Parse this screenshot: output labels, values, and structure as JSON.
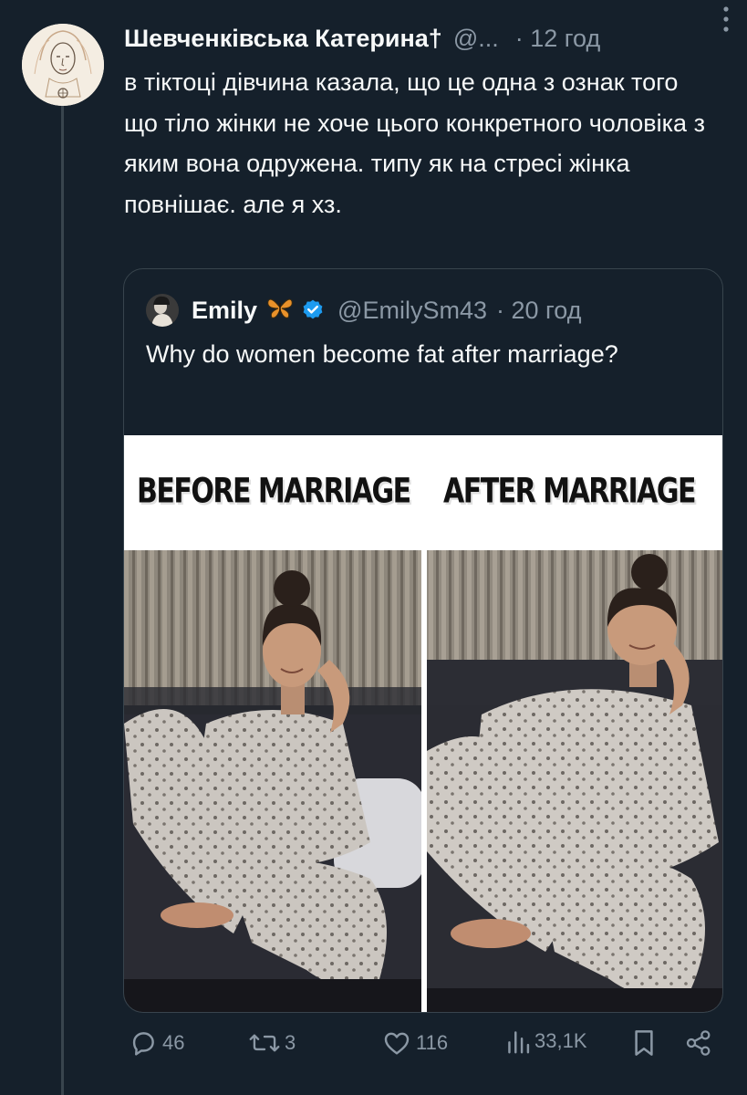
{
  "author": {
    "display_name": "Шевченківська Катерина†",
    "handle": "@...",
    "time": "· 12 год"
  },
  "tweet_text": "в тіктоці дівчина казала, що це одна з ознак того що тіло жінки не хоче цього конкретного чоловіка з яким вона одружена. типу як на стресі жінка повнішає. але я хз.",
  "quote": {
    "display_name": "Emily",
    "handle": "@EmilySm43",
    "time": "· 20 год",
    "text": "Why do women become fat after marriage?",
    "meme": {
      "label_before": "BEFORE MARRIAGE",
      "label_after": "AFTER MARRIAGE"
    }
  },
  "actions": {
    "replies": "46",
    "retweets": "3",
    "likes": "116",
    "views": "33,1K"
  },
  "icons": [
    "more-icon",
    "verified-badge-icon",
    "butterfly-icon",
    "reply-icon",
    "retweet-icon",
    "like-icon",
    "views-icon",
    "bookmark-icon",
    "share-icon"
  ],
  "colors": {
    "background": "#15202b",
    "text": "#f7f9f9",
    "secondary": "#8b98a5",
    "border": "#38444d",
    "verified": "#1d9bf0"
  }
}
